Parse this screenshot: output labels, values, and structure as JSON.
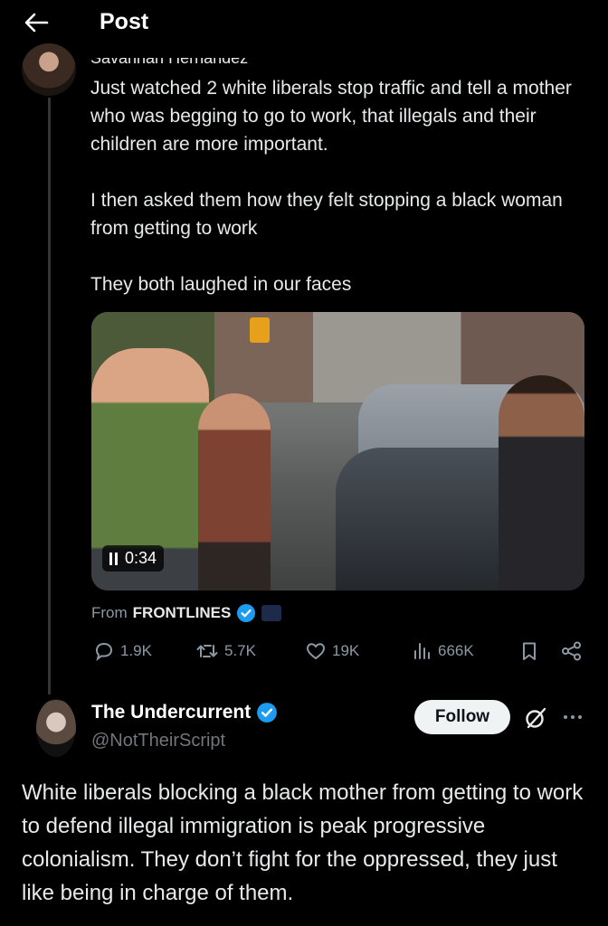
{
  "header": {
    "title": "Post",
    "back_icon": "arrow-left-icon"
  },
  "tweet1": {
    "author_cut": "Savannah Hernandez",
    "paragraphs": [
      "Just watched 2 white liberals stop traffic and tell a mother who was begging to go to work, that illegals and their children are more important.",
      "I then asked them how they felt stopping a black woman from getting to work",
      "They both laughed in our faces"
    ],
    "video": {
      "timer": "0:34"
    },
    "from_prefix": "From",
    "from_source": "FRONTLINES",
    "stats": {
      "replies": "1.9K",
      "reposts": "5.7K",
      "likes": "19K",
      "views": "666K"
    }
  },
  "tweet2": {
    "author_name": "The Undercurrent",
    "handle": "@NotTheirScript",
    "follow_label": "Follow",
    "text": "White liberals blocking a black mother from getting to work to defend illegal immigration is peak progressive colonialism. They don’t fight for the oppressed, they just like being in charge of them."
  },
  "colors": {
    "background": "#000000",
    "text": "#e7e9ea",
    "muted": "#71767b",
    "verified": "#1d9bf0"
  }
}
